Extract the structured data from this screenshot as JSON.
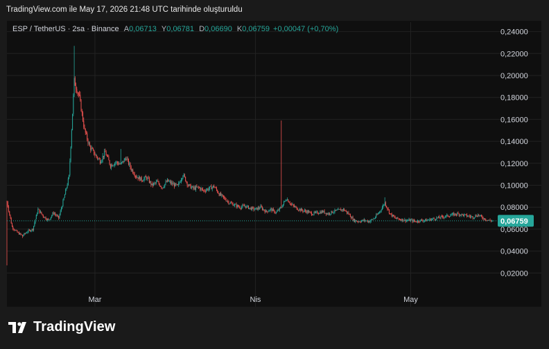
{
  "caption": "TradingView.com ile May 17, 2026 21:48 UTC tarihinde oluşturuldu",
  "legend": {
    "symbol": "ESP / TetherUS · 2sa · Binance",
    "open_key": "A",
    "open": "0,06713",
    "high_key": "Y",
    "high": "0,06781",
    "low_key": "D",
    "low": "0,06690",
    "close_key": "K",
    "close": "0,06759",
    "change": "+0,00047 (+0,70%)"
  },
  "brand": "TradingView",
  "colors": {
    "up": "#26a69a",
    "down": "#ef5350",
    "price_tag": "#26a69a",
    "background": "#0f0f0f",
    "grid": "#222222"
  },
  "chart_data": {
    "type": "candlestick",
    "price_axis_position": "right",
    "ylim": [
      0.0,
      0.245
    ],
    "y_ticks": [
      "0,02000",
      "0,04000",
      "0,06000",
      "0,08000",
      "0,10000",
      "0,12000",
      "0,14000",
      "0,16000",
      "0,18000",
      "0,20000",
      "0,22000",
      "0,24000"
    ],
    "y_tick_values": [
      0.02,
      0.04,
      0.06,
      0.08,
      0.1,
      0.12,
      0.14,
      0.16,
      0.18,
      0.2,
      0.22,
      0.24
    ],
    "x_ticks": [
      "Mar",
      "Nis",
      "May"
    ],
    "x_tick_dates": [
      "2026-03-01",
      "2026-04-01",
      "2026-05-01"
    ],
    "x_range": [
      "2026-02-12",
      "2026-05-17"
    ],
    "last_price": 0.06759,
    "last_price_label": "0,06759",
    "close_series": [
      [
        "2026-02-12",
        0.085
      ],
      [
        "2026-02-13",
        0.062
      ],
      [
        "2026-02-14",
        0.057
      ],
      [
        "2026-02-15",
        0.054
      ],
      [
        "2026-02-16",
        0.058
      ],
      [
        "2026-02-17",
        0.06
      ],
      [
        "2026-02-18",
        0.078
      ],
      [
        "2026-02-19",
        0.072
      ],
      [
        "2026-02-20",
        0.068
      ],
      [
        "2026-02-21",
        0.075
      ],
      [
        "2026-02-22",
        0.07
      ],
      [
        "2026-02-23",
        0.088
      ],
      [
        "2026-02-24",
        0.108
      ],
      [
        "2026-02-25",
        0.195
      ],
      [
        "2026-02-26",
        0.18
      ],
      [
        "2026-02-27",
        0.15
      ],
      [
        "2026-02-28",
        0.135
      ],
      [
        "2026-03-01",
        0.128
      ],
      [
        "2026-03-02",
        0.122
      ],
      [
        "2026-03-03",
        0.13
      ],
      [
        "2026-03-04",
        0.118
      ],
      [
        "2026-03-05",
        0.121
      ],
      [
        "2026-03-06",
        0.119
      ],
      [
        "2026-03-07",
        0.125
      ],
      [
        "2026-03-08",
        0.115
      ],
      [
        "2026-03-09",
        0.108
      ],
      [
        "2026-03-10",
        0.105
      ],
      [
        "2026-03-11",
        0.107
      ],
      [
        "2026-03-12",
        0.1
      ],
      [
        "2026-03-13",
        0.103
      ],
      [
        "2026-03-14",
        0.098
      ],
      [
        "2026-03-15",
        0.104
      ],
      [
        "2026-03-16",
        0.101
      ],
      [
        "2026-03-17",
        0.099
      ],
      [
        "2026-03-18",
        0.11
      ],
      [
        "2026-03-19",
        0.1
      ],
      [
        "2026-03-20",
        0.097
      ],
      [
        "2026-03-21",
        0.098
      ],
      [
        "2026-03-22",
        0.095
      ],
      [
        "2026-03-23",
        0.097
      ],
      [
        "2026-03-24",
        0.099
      ],
      [
        "2026-03-25",
        0.092
      ],
      [
        "2026-03-26",
        0.088
      ],
      [
        "2026-03-27",
        0.084
      ],
      [
        "2026-03-28",
        0.082
      ],
      [
        "2026-03-29",
        0.08
      ],
      [
        "2026-03-30",
        0.081
      ],
      [
        "2026-03-31",
        0.079
      ],
      [
        "2026-04-01",
        0.078
      ],
      [
        "2026-04-02",
        0.08
      ],
      [
        "2026-04-03",
        0.076
      ],
      [
        "2026-04-04",
        0.078
      ],
      [
        "2026-04-05",
        0.075
      ],
      [
        "2026-04-06",
        0.08
      ],
      [
        "2026-04-07",
        0.088
      ],
      [
        "2026-04-08",
        0.082
      ],
      [
        "2026-04-09",
        0.079
      ],
      [
        "2026-04-10",
        0.077
      ],
      [
        "2026-04-11",
        0.076
      ],
      [
        "2026-04-12",
        0.074
      ],
      [
        "2026-04-13",
        0.075
      ],
      [
        "2026-04-14",
        0.076
      ],
      [
        "2026-04-15",
        0.074
      ],
      [
        "2026-04-16",
        0.076
      ],
      [
        "2026-04-17",
        0.077
      ],
      [
        "2026-04-18",
        0.078
      ],
      [
        "2026-04-19",
        0.074
      ],
      [
        "2026-04-20",
        0.068
      ],
      [
        "2026-04-21",
        0.067
      ],
      [
        "2026-04-22",
        0.068
      ],
      [
        "2026-04-23",
        0.067
      ],
      [
        "2026-04-24",
        0.07
      ],
      [
        "2026-04-25",
        0.076
      ],
      [
        "2026-04-26",
        0.084
      ],
      [
        "2026-04-27",
        0.074
      ],
      [
        "2026-04-28",
        0.07
      ],
      [
        "2026-04-29",
        0.069
      ],
      [
        "2026-04-30",
        0.068
      ],
      [
        "2026-05-01",
        0.068
      ],
      [
        "2026-05-02",
        0.067
      ],
      [
        "2026-05-03",
        0.068
      ],
      [
        "2026-05-04",
        0.068
      ],
      [
        "2026-05-05",
        0.069
      ],
      [
        "2026-05-06",
        0.07
      ],
      [
        "2026-05-07",
        0.071
      ],
      [
        "2026-05-08",
        0.072
      ],
      [
        "2026-05-09",
        0.073
      ],
      [
        "2026-05-10",
        0.074
      ],
      [
        "2026-05-11",
        0.073
      ],
      [
        "2026-05-12",
        0.072
      ],
      [
        "2026-05-13",
        0.071
      ],
      [
        "2026-05-14",
        0.073
      ],
      [
        "2026-05-15",
        0.07
      ],
      [
        "2026-05-16",
        0.068
      ],
      [
        "2026-05-17",
        0.0676
      ]
    ],
    "notable_highs": [
      [
        "2026-02-25",
        0.227
      ],
      [
        "2026-03-06",
        0.133
      ],
      [
        "2026-04-06",
        0.159
      ],
      [
        "2026-04-26",
        0.089
      ]
    ],
    "notable_lows": [
      [
        "2026-02-12",
        0.027
      ],
      [
        "2026-02-15",
        0.052
      ]
    ]
  }
}
